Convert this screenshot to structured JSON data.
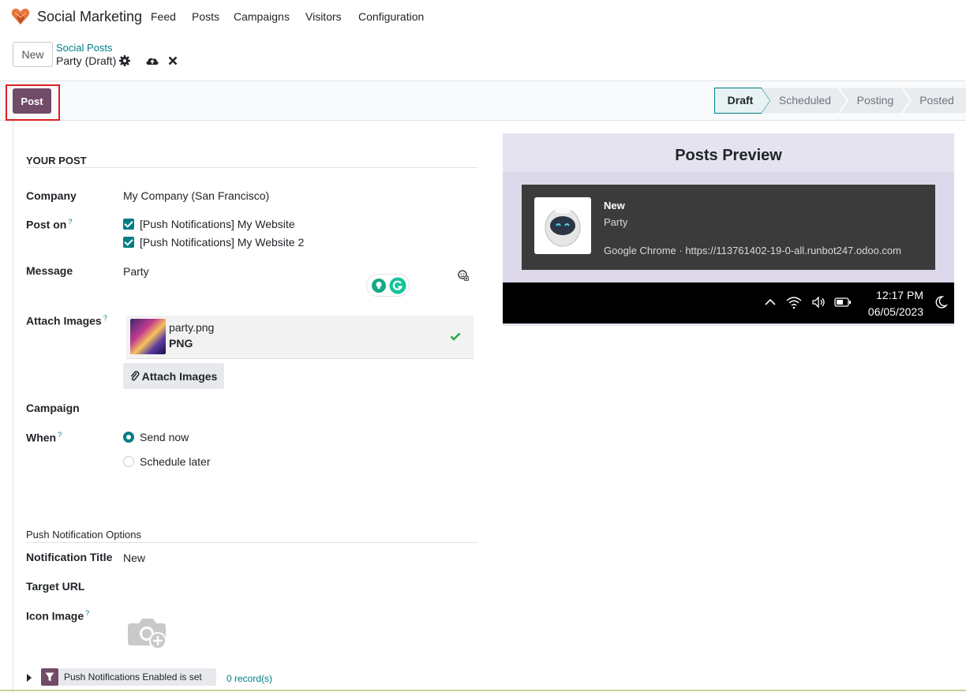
{
  "app": {
    "brand": "Social Marketing",
    "menu": [
      "Feed",
      "Posts",
      "Campaigns",
      "Visitors",
      "Configuration"
    ]
  },
  "control_panel": {
    "new_label": "New",
    "breadcrumb_parent": "Social Posts",
    "breadcrumb_current": "Party (Draft)"
  },
  "statusbar": {
    "post_label": "Post",
    "stages": [
      "Draft",
      "Scheduled",
      "Posting",
      "Posted"
    ],
    "active_stage": "Draft"
  },
  "form": {
    "section_title": "YOUR POST",
    "company_label": "Company",
    "company_value": "My Company (San Francisco)",
    "post_on_label": "Post on",
    "post_on_options": [
      "[Push Notifications] My Website",
      "[Push Notifications] My Website 2"
    ],
    "message_label": "Message",
    "message_value": "Party",
    "attach_label": "Attach Images",
    "attachment_name": "party.png",
    "attachment_type": "PNG",
    "attach_button": "Attach Images",
    "campaign_label": "Campaign",
    "when_label": "When",
    "when_options": [
      "Send now",
      "Schedule later"
    ],
    "when_selected": "Send now",
    "help_mark": "?",
    "push_section_title": "Push Notification Options",
    "notif_title_label": "Notification Title",
    "notif_title_value": "New",
    "target_url_label": "Target URL",
    "icon_image_label": "Icon Image"
  },
  "filter": {
    "chip_label": "Push Notifications Enabled is set",
    "records": "0 record(s)"
  },
  "preview": {
    "title": "Posts Preview",
    "notif_title": "New",
    "notif_body": "Party",
    "notif_source": "Google Chrome · https://113761402-19-0-all.runbot247.odoo.com",
    "time": "12:17 PM",
    "date": "06/05/2023"
  },
  "colors": {
    "primary": "#714b67",
    "accent": "#017e84",
    "highlight_box": "#e02020"
  }
}
